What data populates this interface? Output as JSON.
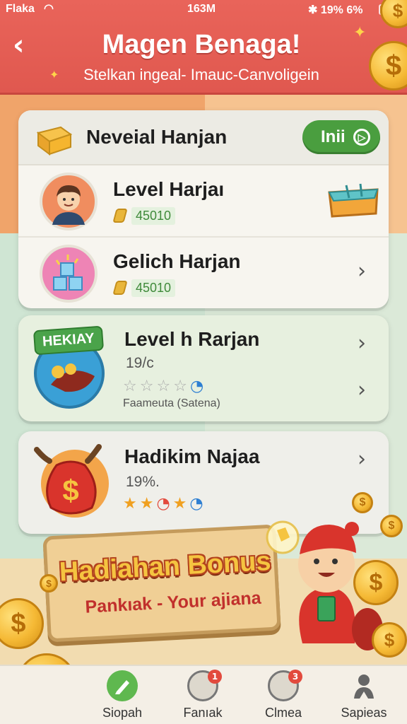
{
  "status_bar": {
    "carrier": "Flaka",
    "time": "163M",
    "right": "19% 6%"
  },
  "header": {
    "title": "Magen Benaga!",
    "subtitle": "Stelkan ingeal- Imauc-Canvoligein"
  },
  "main_card": {
    "title": "Neveial Hanjan",
    "action_label": "Inii",
    "rows": [
      {
        "title": "Level Harjaı",
        "value": "45010"
      },
      {
        "title": "Gelich Harjan",
        "value": "45010"
      }
    ]
  },
  "card_b": {
    "badge": "HEKIAY",
    "title": "Level h Rarjan",
    "percent": "19/c",
    "sub": "Faameuta (Satena)"
  },
  "card_c": {
    "title": "Hadikim Najaa",
    "percent": "19%."
  },
  "banner": {
    "title": "Hadiahan Bonus",
    "subtitle": "Pankıak - Your ajiana"
  },
  "bottom_nav": {
    "items": [
      {
        "label": "Siopah",
        "icon": "pen-icon",
        "badge": ""
      },
      {
        "label": "Fanıak",
        "icon": "helmet-icon",
        "badge": "1"
      },
      {
        "label": "Clmea",
        "icon": "gauge-icon",
        "badge": "3"
      },
      {
        "label": "Sapieas",
        "icon": "person-icon",
        "badge": ""
      }
    ]
  },
  "colors": {
    "header_red": "#e0584f",
    "green_button": "#4a9e3f",
    "coin_gold": "#f5b935"
  }
}
